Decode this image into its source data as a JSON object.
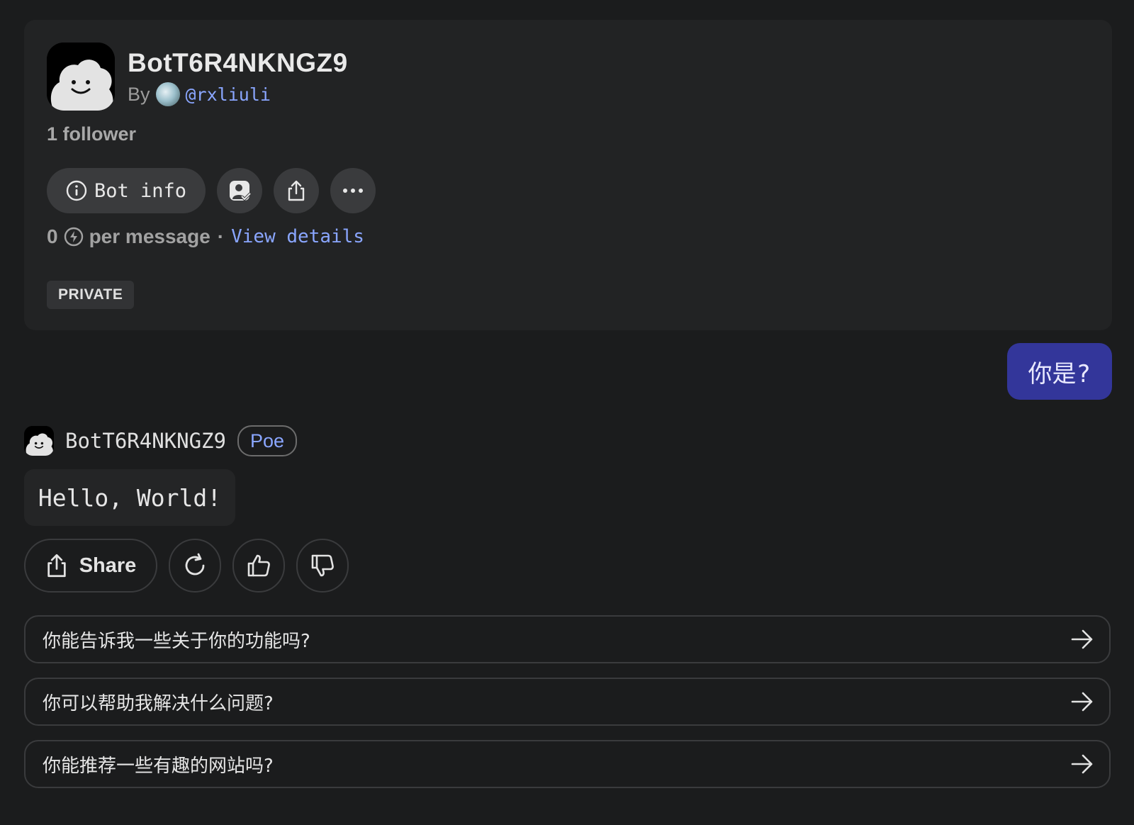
{
  "bot": {
    "name": "BotT6R4NKNGZ9",
    "by_label": "By",
    "creator_handle": "@rxliuli",
    "followers": "1 follower",
    "bot_info_label": "Bot info",
    "price_value": "0",
    "price_suffix": "per message",
    "price_separator": "·",
    "view_details_label": "View details",
    "visibility_badge": "PRIVATE"
  },
  "conversation": {
    "user_message": "你是?",
    "bot_name": "BotT6R4NKNGZ9",
    "bot_badge": "Poe",
    "bot_reply": "Hello, World!",
    "share_label": "Share"
  },
  "suggestions": [
    "你能告诉我一些关于你的功能吗?",
    "你可以帮助我解决什么问题?",
    "你能推荐一些有趣的网站吗?"
  ],
  "colors": {
    "background": "#1b1c1d",
    "card": "#222324",
    "accent_link": "#8aa6ff",
    "user_bubble": "#33369a"
  }
}
